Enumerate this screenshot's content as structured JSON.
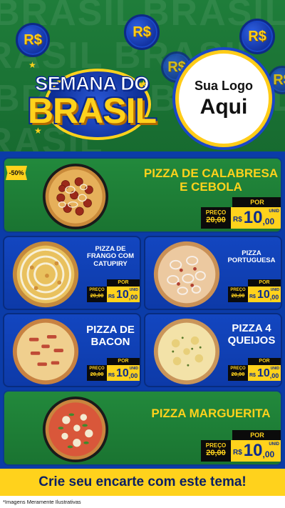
{
  "header": {
    "bg_word": "BRASIL",
    "coin_symbol": "R$",
    "title_top": "SEMANA DO",
    "title_main": "BRASIL",
    "logo_line1": "Sua Logo",
    "logo_line2": "Aqui"
  },
  "featured": [
    {
      "name": "PIZZA DE CALABRESA E CEBOLA",
      "badge": "-50%",
      "old_label": "PREÇO",
      "old_price": "20,00",
      "por": "POR",
      "currency": "R$",
      "price_int": "10",
      "price_dec": ",00",
      "unit": "UNID"
    },
    {
      "name": "PIZZA MARGUERITA",
      "old_label": "PREÇO",
      "old_price": "20,00",
      "por": "POR",
      "currency": "R$",
      "price_int": "10",
      "price_dec": ",00",
      "unit": "UNID"
    }
  ],
  "grid": [
    {
      "name": "PIZZA DE FRANGO COM CATUPIRY",
      "old_label": "PREÇO",
      "old_price": "20,00",
      "por": "POR",
      "currency": "R$",
      "price_int": "10",
      "price_dec": ",00",
      "unit": "UNID"
    },
    {
      "name": "PIZZA PORTUGUESA",
      "old_label": "PREÇO",
      "old_price": "20,00",
      "por": "POR",
      "currency": "R$",
      "price_int": "10",
      "price_dec": ",00",
      "unit": "UNID"
    },
    {
      "name": "PIZZA DE BACON",
      "old_label": "PREÇO",
      "old_price": "20,00",
      "por": "POR",
      "currency": "R$",
      "price_int": "10",
      "price_dec": ",00",
      "unit": "UNID"
    },
    {
      "name": "PIZZA 4 QUEIJOS",
      "old_label": "PREÇO",
      "old_price": "20,00",
      "por": "POR",
      "currency": "R$",
      "price_int": "10",
      "price_dec": ",00",
      "unit": "UNID"
    }
  ],
  "banner": "Crie seu encarte com este tema!",
  "footer": "*Imagens Meramente Ilustrativas",
  "colors": {
    "green": "#1f7d3a",
    "blue": "#0d3aa8",
    "yellow": "#ffd21c",
    "dark": "#0b0b0b"
  }
}
